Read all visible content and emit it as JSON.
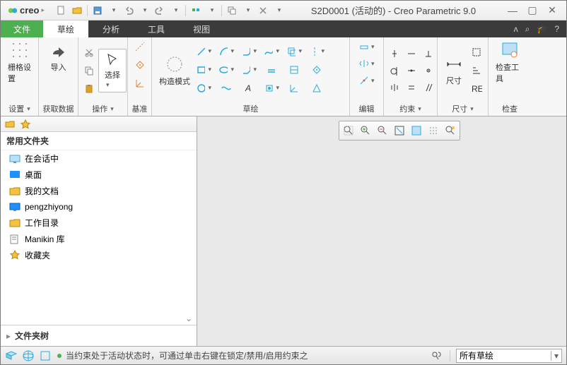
{
  "app": {
    "logo_text": "creo",
    "title": "S2D0001 (活动的) - Creo Parametric 9.0"
  },
  "menu": {
    "file": "文件",
    "items": [
      "草绘",
      "分析",
      "工具",
      "视图"
    ],
    "active": 0
  },
  "ribbon": {
    "groups": [
      {
        "label": "设置",
        "buttons": [
          {
            "name": "grid-settings",
            "label": "栅格设置"
          }
        ]
      },
      {
        "label": "获取数据",
        "buttons": [
          {
            "name": "import",
            "label": "导入"
          }
        ]
      },
      {
        "label": "操作",
        "buttons": [
          {
            "name": "select",
            "label": "选择"
          }
        ]
      },
      {
        "label": "基准",
        "buttons": []
      },
      {
        "label": "草绘",
        "buttons": [
          {
            "name": "construction-mode",
            "label": "构造模式"
          }
        ]
      },
      {
        "label": "编辑",
        "buttons": []
      },
      {
        "label": "约束",
        "buttons": []
      },
      {
        "label": "尺寸",
        "buttons": [
          {
            "name": "dimension",
            "label": "尺寸"
          }
        ]
      },
      {
        "label": "检查",
        "buttons": [
          {
            "name": "inspect-tools",
            "label": "检查工具"
          }
        ]
      }
    ]
  },
  "sidebar": {
    "header": "常用文件夹",
    "items": [
      {
        "icon": "monitor",
        "label": "在会话中",
        "color": "#3ba7e0"
      },
      {
        "icon": "folder",
        "label": "桌面",
        "color": "#1e90ff"
      },
      {
        "icon": "folder",
        "label": "我的文档",
        "color": "#e0a030"
      },
      {
        "icon": "monitor",
        "label": "pengzhiyong",
        "color": "#1e90ff"
      },
      {
        "icon": "folder",
        "label": "工作目录",
        "color": "#e0a030"
      },
      {
        "icon": "book",
        "label": "Manikin 库",
        "color": "#888"
      },
      {
        "icon": "star",
        "label": "收藏夹",
        "color": "#e0a030"
      }
    ],
    "footer": "文件夹树"
  },
  "status": {
    "message": "当约束处于活动状态时，可通过单击右键在锁定/禁用/启用约束之",
    "combo": "所有草绘"
  }
}
